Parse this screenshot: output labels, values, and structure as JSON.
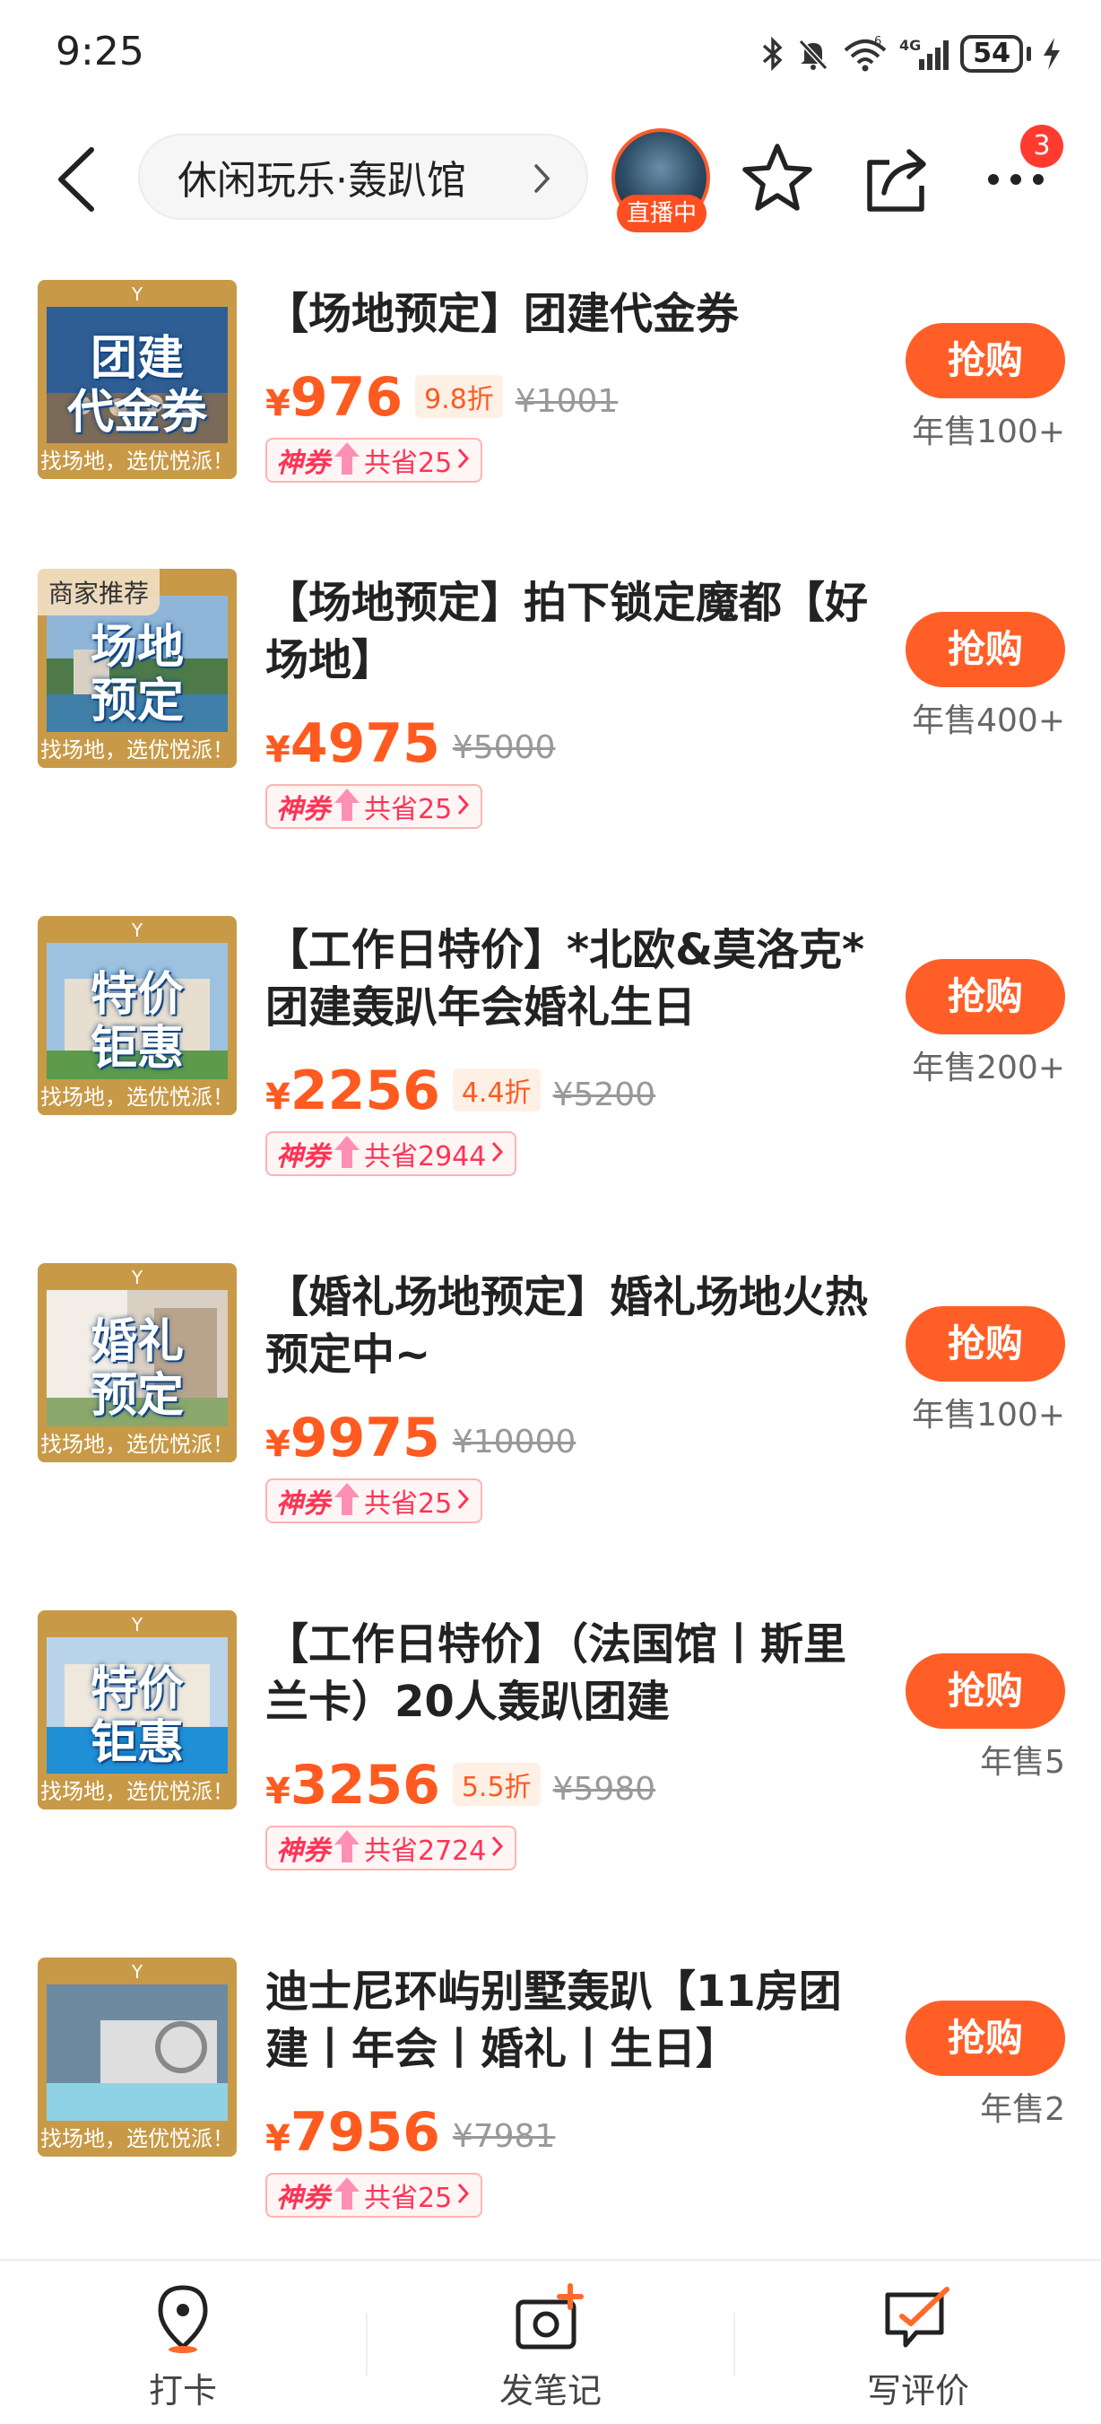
{
  "status_bar": {
    "time": "9:25",
    "battery": "54"
  },
  "nav": {
    "breadcrumb": "休闲玩乐·轰趴馆",
    "live_label": "直播中",
    "more_badge": "3"
  },
  "products": [
    {
      "title": "【场地预定】团建代金券",
      "thumb_text": "团建\n代金券",
      "thumb_tag": "",
      "thumb_footer": "找场地，选优悦派！",
      "currency": "¥",
      "price": "976",
      "discount": "9.8折",
      "original_price": "¥1001",
      "coupon_brand": "神券",
      "coupon_saving": "共省25",
      "buy_label": "抢购",
      "sales": "年售100+"
    },
    {
      "title": "【场地预定】拍下锁定魔都【好场地】",
      "thumb_text": "场地\n预定",
      "thumb_tag": "商家推荐",
      "thumb_footer": "找场地，选优悦派！",
      "currency": "¥",
      "price": "4975",
      "discount": "",
      "original_price": "¥5000",
      "coupon_brand": "神券",
      "coupon_saving": "共省25",
      "buy_label": "抢购",
      "sales": "年售400+"
    },
    {
      "title": "【工作日特价】*北欧&莫洛克*团建轰趴年会婚礼生日",
      "thumb_text": "特价\n钜惠",
      "thumb_tag": "",
      "thumb_footer": "找场地，选优悦派！",
      "currency": "¥",
      "price": "2256",
      "discount": "4.4折",
      "original_price": "¥5200",
      "coupon_brand": "神券",
      "coupon_saving": "共省2944",
      "buy_label": "抢购",
      "sales": "年售200+"
    },
    {
      "title": "【婚礼场地预定】婚礼场地火热预定中~",
      "thumb_text": "婚礼\n预定",
      "thumb_tag": "",
      "thumb_footer": "找场地，选优悦派！",
      "currency": "¥",
      "price": "9975",
      "discount": "",
      "original_price": "¥10000",
      "coupon_brand": "神券",
      "coupon_saving": "共省25",
      "buy_label": "抢购",
      "sales": "年售100+"
    },
    {
      "title": "【工作日特价】（法国馆丨斯里兰卡）20人轰趴团建",
      "thumb_text": "特价\n钜惠",
      "thumb_tag": "",
      "thumb_footer": "找场地，选优悦派！",
      "currency": "¥",
      "price": "3256",
      "discount": "5.5折",
      "original_price": "¥5980",
      "coupon_brand": "神券",
      "coupon_saving": "共省2724",
      "buy_label": "抢购",
      "sales": "年售5"
    },
    {
      "title": "迪士尼环屿别墅轰趴【11房团建丨年会丨婚礼丨生日】",
      "thumb_text": "",
      "thumb_tag": "",
      "thumb_footer": "找场地，选优悦派！",
      "currency": "¥",
      "price": "7956",
      "discount": "",
      "original_price": "¥7981",
      "coupon_brand": "神券",
      "coupon_saving": "共省25",
      "buy_label": "抢购",
      "sales": "年售2"
    }
  ],
  "bottom_bar": {
    "checkin": "打卡",
    "post_note": "发笔记",
    "write_review": "写评价"
  },
  "colors": {
    "accent": "#ff5f27",
    "price": "#ff5a1f",
    "coupon": "#ff3355",
    "thumb_gold": "#c89a48"
  }
}
